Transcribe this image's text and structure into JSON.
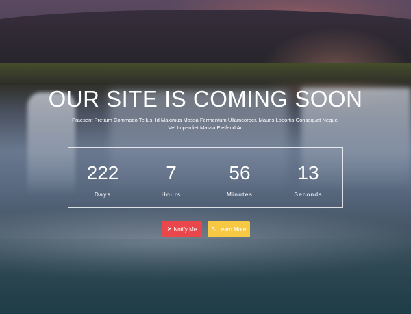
{
  "hero": {
    "title": "OUR SITE IS COMING SOON",
    "subtitle": "Praesent Pretium Commodo Tellus, Id Maximus Massa Fermentum Ullamcorper. Mauris Lobortis Consequat Neque, Vel Imperdiet Massa Eleifend Ac"
  },
  "countdown": [
    {
      "value": "222",
      "label": "Days"
    },
    {
      "value": "7",
      "label": "Hours"
    },
    {
      "value": "56",
      "label": "Minutes"
    },
    {
      "value": "13",
      "label": "Seconds"
    }
  ],
  "buttons": {
    "notify": {
      "label": "Notify Me",
      "icon": "paper-plane-icon",
      "color": "#e9474c"
    },
    "learn": {
      "label": "Learn More",
      "icon": "pointer-icon",
      "color": "#f6c843"
    }
  }
}
